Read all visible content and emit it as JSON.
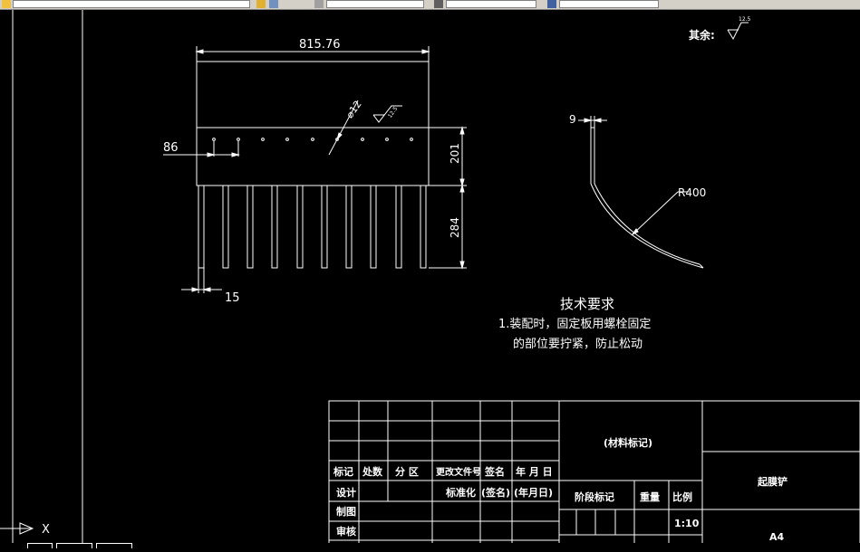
{
  "drawing": {
    "top_dimension": "815.76",
    "left_dimension": "86",
    "hole_dimension": "⌀12",
    "height_plate": "201",
    "height_rods": "284",
    "rod_width": "15",
    "radius": "R400",
    "thickness": "9",
    "roughness_top": "12.5",
    "roughness_small": "12.5",
    "remaining_label": "其余:"
  },
  "tech_requirements": {
    "title": "技术要求",
    "line1": "1.装配时，固定板用螺栓固定",
    "line2": "的部位要拧紧，防止松动"
  },
  "title_block": {
    "material_mark": "(材料标记)",
    "part_name": "起膜铲",
    "sheet_size": "A4",
    "scale_label": "比例",
    "scale_value": "1:10",
    "weight_label": "重量",
    "stage_label": "阶段标记",
    "headers": [
      "标记",
      "处数",
      "分 区",
      "更改文件号",
      "签名",
      "年 月 日"
    ],
    "design": "设计",
    "standardize": "标准化",
    "sign_paren": "(签名)",
    "date_paren": "(年月日)",
    "drafting": "制图",
    "review": "审核"
  },
  "ucs": {
    "x_label": "X"
  },
  "colors": {
    "background": "#000000",
    "lines": "#ffffff",
    "toolbar": "#d4d0c8"
  }
}
